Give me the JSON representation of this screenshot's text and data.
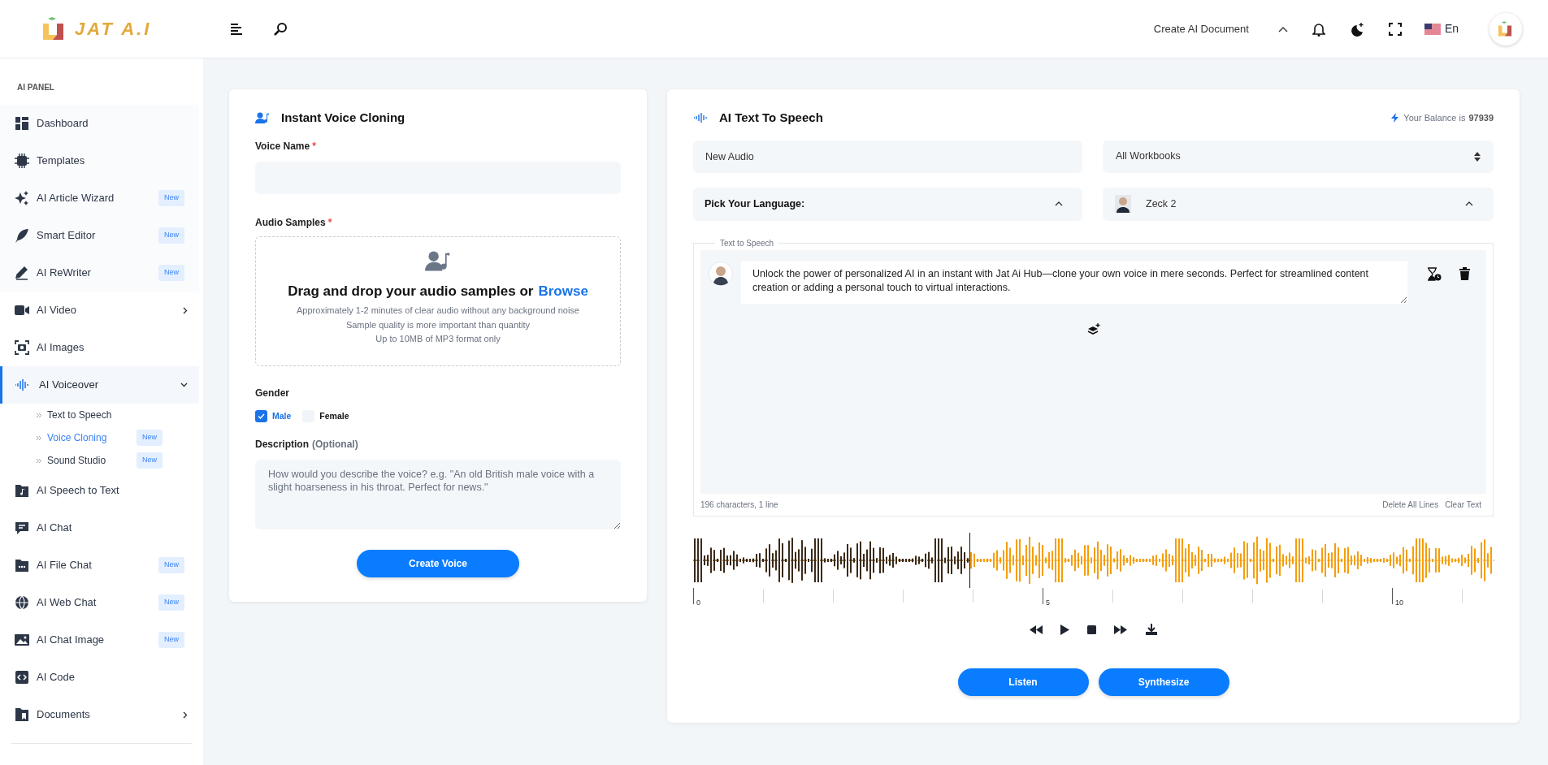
{
  "header": {
    "logo_text": "JAT A.I",
    "create_document": "Create AI Document",
    "language": "En"
  },
  "sidebar": {
    "section_title": "AI PANEL",
    "items": [
      {
        "label": "Dashboard",
        "selected": false
      },
      {
        "label": "Templates",
        "selected": false
      },
      {
        "label": "AI Article Wizard",
        "badge": "New",
        "selected": false
      },
      {
        "label": "Smart Editor",
        "badge": "New",
        "selected": false
      },
      {
        "label": "AI ReWriter",
        "badge": "New",
        "selected": false
      },
      {
        "label": "AI Video",
        "expanded": false,
        "selected": false
      },
      {
        "label": "AI Images",
        "selected": false
      },
      {
        "label": "AI Voiceover",
        "expanded": true,
        "selected": true,
        "children": [
          {
            "label": "Text to Speech",
            "selected": false
          },
          {
            "label": "Voice Cloning",
            "badge": "New",
            "selected": true
          },
          {
            "label": "Sound Studio",
            "badge": "New",
            "selected": false
          }
        ]
      },
      {
        "label": "AI Speech to Text",
        "selected": false
      },
      {
        "label": "AI Chat",
        "selected": false
      },
      {
        "label": "AI File Chat",
        "badge": "New",
        "selected": false
      },
      {
        "label": "AI Web Chat",
        "badge": "New",
        "selected": false
      },
      {
        "label": "AI Chat Image",
        "badge": "New",
        "selected": false
      },
      {
        "label": "AI Code",
        "selected": false
      },
      {
        "label": "Documents",
        "expanded": false,
        "selected": false
      }
    ]
  },
  "voice_cloning": {
    "title": "Instant Voice Cloning",
    "voice_name": {
      "label": "Voice Name",
      "required_mark": "*"
    },
    "audio_samples": {
      "label": "Audio Samples",
      "required_mark": "*",
      "drop_text": "Drag and drop your audio samples or",
      "browse_link": "Browse",
      "hints": [
        "Approximately 1-2 minutes of clear audio without any background noise",
        "Sample quality is more important than quantity",
        "Up to 10MB of MP3 format only"
      ]
    },
    "gender": {
      "label": "Gender",
      "options": [
        {
          "label": "Male",
          "checked": true
        },
        {
          "label": "Female",
          "checked": false
        }
      ]
    },
    "description": {
      "label": "Description",
      "optional": "(Optional)",
      "placeholder": "How would you describe the voice? e.g. \"An old British male voice with a slight hoarseness in his throat. Perfect for news.\""
    },
    "button": "Create Voice"
  },
  "text_to_speech": {
    "title": "AI Text To Speech",
    "balance_label": "Your Balance is",
    "balance": "97939",
    "audio_name": "New Audio",
    "workbook": "All Workbooks",
    "language_placeholder": "Pick Your Language:",
    "voice": "Zeck 2",
    "editor_legend": "Text to Speech",
    "lines": [
      "Unlock the power of personalized AI in an instant with Jat Ai Hub—clone your own voice in mere seconds. Perfect for streamlined content creation or adding a personal touch to virtual interactions."
    ],
    "counter": "196 characters, 1 line",
    "delete_all": "Delete All Lines",
    "clear_text": "Clear Text",
    "player": {
      "level": 0.345,
      "axis_labels": [
        "0",
        "5",
        "10"
      ]
    },
    "buttons": [
      "Listen",
      "Synthesize"
    ]
  }
}
